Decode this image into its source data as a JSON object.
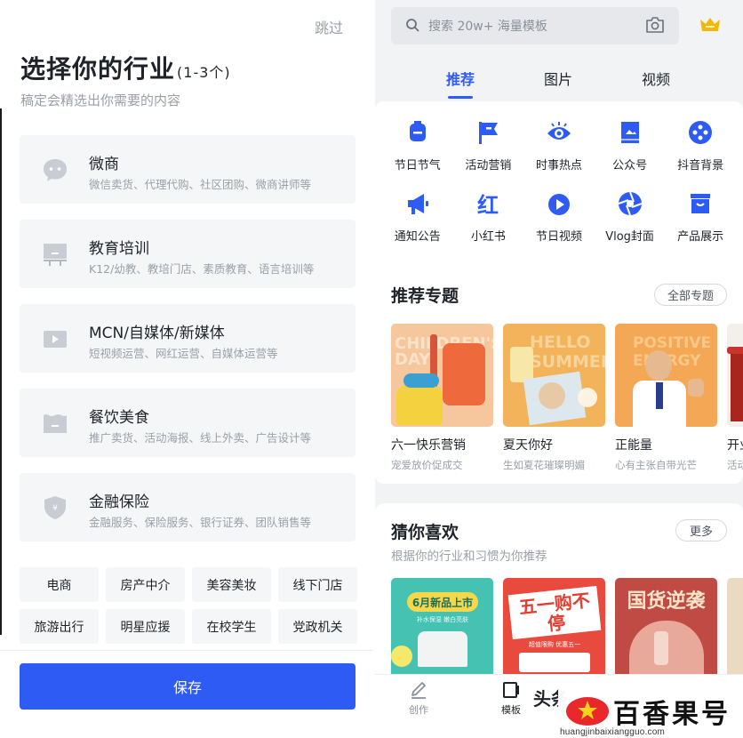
{
  "left": {
    "skip_label": "跳过",
    "title": "选择你的行业",
    "title_sub": "(1-3个)",
    "description": "稿定会精选出你需要的内容",
    "industries": [
      {
        "name": "微商",
        "desc": "微信卖货、代理代购、社区团购、微商讲师等",
        "icon": "chat-bubble-icon"
      },
      {
        "name": "教育培训",
        "desc": "K12/幼教、教培门店、素质教育、语言培训等",
        "icon": "blackboard-icon"
      },
      {
        "name": "MCN/自媒体/新媒体",
        "desc": "短视频运营、网红运营、自媒体运营等",
        "icon": "video-camera-icon"
      },
      {
        "name": "餐饮美食",
        "desc": "推广卖货、活动海报、线上外卖、广告设计等",
        "icon": "food-bowl-icon"
      },
      {
        "name": "金融保险",
        "desc": "金融服务、保险服务、银行证券、团队销售等",
        "icon": "shield-icon"
      }
    ],
    "tags": [
      "电商",
      "房产中介",
      "美容美妆",
      "线下门店",
      "旅游出行",
      "明星应援",
      "在校学生",
      "党政机关"
    ],
    "save_label": "保存"
  },
  "right": {
    "search_placeholder": "搜索 20w+ 海量模板",
    "tabs": [
      "推荐",
      "图片",
      "视频"
    ],
    "categories": [
      {
        "label": "节日节气",
        "icon": "lantern-icon"
      },
      {
        "label": "活动营销",
        "icon": "flag-icon"
      },
      {
        "label": "时事热点",
        "icon": "eye-icon"
      },
      {
        "label": "公众号",
        "icon": "book-icon"
      },
      {
        "label": "抖音背景",
        "icon": "film-reel-icon"
      },
      {
        "label": "通知公告",
        "icon": "megaphone-icon"
      },
      {
        "label": "小红书",
        "icon": "red-book-icon"
      },
      {
        "label": "节日视频",
        "icon": "play-icon"
      },
      {
        "label": "Vlog封面",
        "icon": "aperture-icon"
      },
      {
        "label": "产品展示",
        "icon": "box-icon"
      }
    ],
    "featured_title": "推荐专题",
    "featured_more": "全部专题",
    "topics": [
      {
        "name": "六一快乐营销",
        "desc": "宠爱放价促成交",
        "thumb_text": "CHILDREN'S DAY"
      },
      {
        "name": "夏天你好",
        "desc": "生如夏花璀璨明媚",
        "thumb_text": "HELLO SUMMER"
      },
      {
        "name": "正能量",
        "desc": "心有主张自带光芒",
        "thumb_text": "POSITIVE ENERGY"
      },
      {
        "name": "开业",
        "desc": "活动",
        "thumb_text": ""
      }
    ],
    "guess_title": "猜你喜欢",
    "guess_sub": "根据你的行业和习惯为你推荐",
    "guess_more": "更多",
    "recommendations": [
      {
        "text": "6月新品上市",
        "small": "补水保湿 嫩白亮肤"
      },
      {
        "text": "五一购不停",
        "small": "超值限购 优惠五一"
      },
      {
        "text": "国货逆袭",
        "small": ""
      }
    ],
    "bottom_nav": [
      {
        "label": "创作",
        "icon": "pen-icon"
      },
      {
        "label": "模板",
        "icon": "template-icon"
      }
    ],
    "partial_text": "头条"
  },
  "watermark": {
    "brand": "百香果号",
    "url": "huangjinbaixiangguo.com"
  },
  "colors": {
    "accent": "#2f5bf5",
    "background_gray": "#f5f6f8",
    "crown": "#f5b800"
  }
}
